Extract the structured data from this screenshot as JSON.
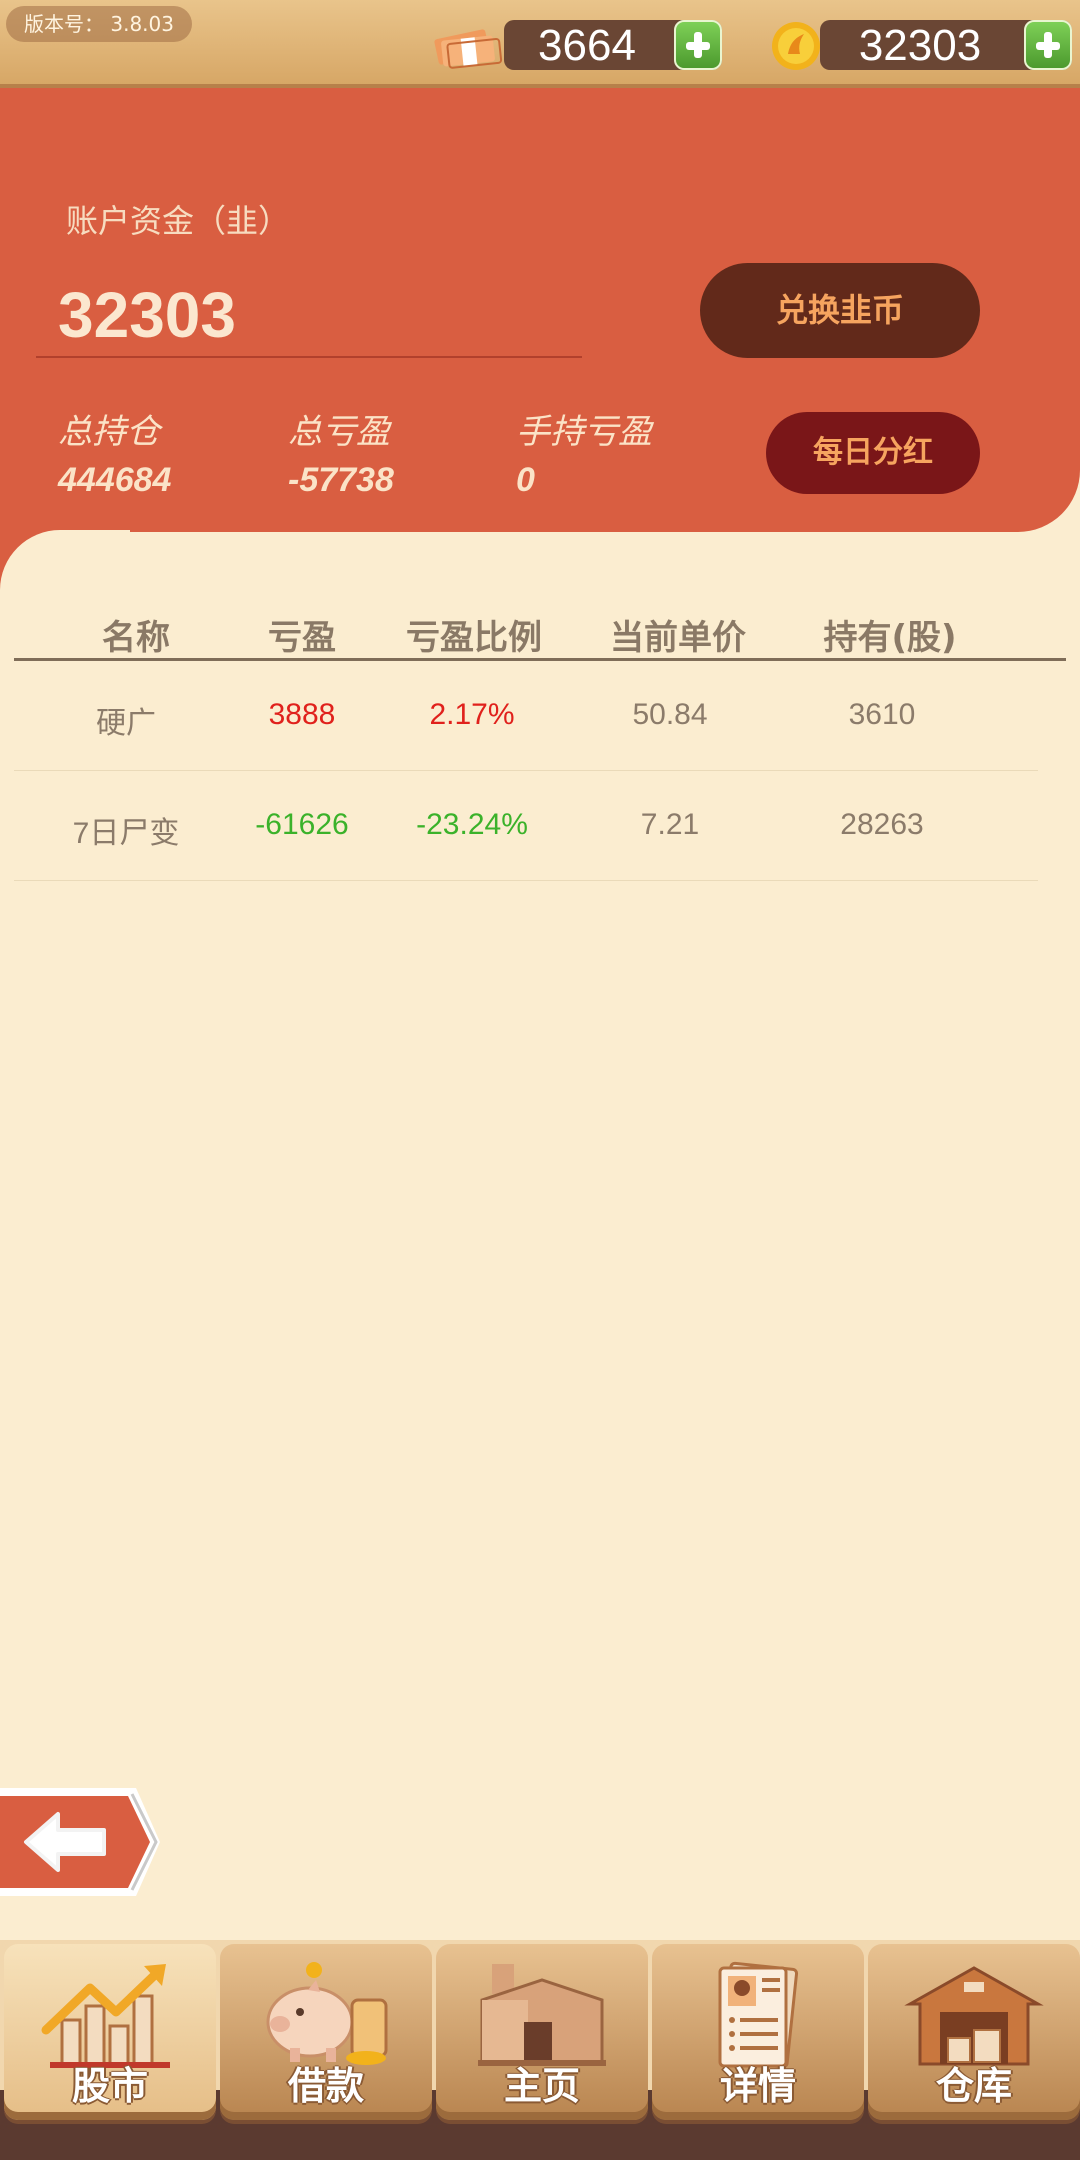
{
  "top_bar": {
    "version_label": "版本号：",
    "version_value": "3.8.03",
    "cash_amount": "3664",
    "coin_amount": "32303"
  },
  "account": {
    "funds_label": "账户资金（韭）",
    "funds_value": "32303",
    "exchange_button": "兑换韭币",
    "dividend_button": "每日分红",
    "stats": [
      {
        "label": "总持仓",
        "value": "444684"
      },
      {
        "label": "总亏盈",
        "value": "-57738"
      },
      {
        "label": "手持亏盈",
        "value": "0"
      }
    ]
  },
  "table": {
    "headers": [
      "名称",
      "亏盈",
      "亏盈比例",
      "当前单价",
      "持有(股)"
    ],
    "rows": [
      {
        "name": "硬广",
        "pnl": "3888",
        "pnl_pct": "2.17%",
        "price": "50.84",
        "held": "3610",
        "trend": "up"
      },
      {
        "name": "7日尸变",
        "pnl": "-61626",
        "pnl_pct": "-23.24%",
        "price": "7.21",
        "held": "28263",
        "trend": "down"
      }
    ]
  },
  "nav": {
    "tabs": [
      {
        "label": "股市",
        "icon": "stock-chart-icon",
        "active": true
      },
      {
        "label": "借款",
        "icon": "piggy-bank-icon",
        "active": false
      },
      {
        "label": "主页",
        "icon": "home-icon",
        "active": false
      },
      {
        "label": "详情",
        "icon": "profile-card-icon",
        "active": false
      },
      {
        "label": "仓库",
        "icon": "warehouse-icon",
        "active": false
      }
    ]
  },
  "colors": {
    "panel": "#d95e41",
    "background": "#fbedd0",
    "profit": "#e0211c",
    "loss": "#3bb22a",
    "exchange_button": "#62291a",
    "dividend_button": "#7a1618"
  }
}
